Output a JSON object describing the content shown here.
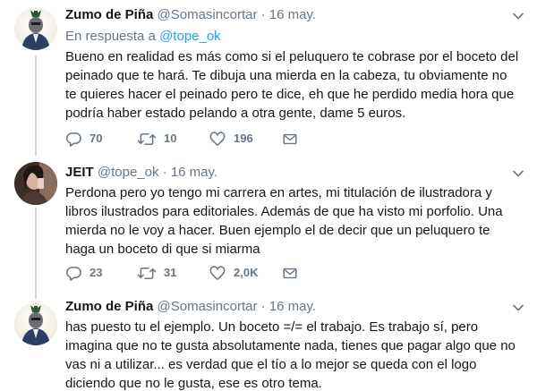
{
  "tweets": [
    {
      "name": "Zumo de Piña",
      "handle": "@Somasincortar",
      "date": "16 may.",
      "replying_prefix": "En respuesta a",
      "replying_to": "@tope_ok",
      "text": "Bueno en realidad es más como si el peluquero te cobrase por el boceto del peinado que te hará. Te dibuja una mierda en la cabeza, tu obviamente no te quieres hacer el peinado pero te dice, eh que he perdido media hora que podría haber estado pelando a otra gente, dame 5 euros.",
      "replies": "70",
      "retweets": "10",
      "likes": "196"
    },
    {
      "name": "JEIT",
      "handle": "@tope_ok",
      "date": "16 may.",
      "text": "Perdona pero yo tengo mi carrera en artes, mi titulación de ilustradora y libros ilustrados para editoriales. Además de que ha visto mi porfolio. Una mierda no le voy a hacer. Buen ejemplo el de decir que un peluquero te haga un boceto di que si miarma",
      "replies": "23",
      "retweets": "31",
      "likes": "2,0K"
    },
    {
      "name": "Zumo de Piña",
      "handle": "@Somasincortar",
      "date": "16 may.",
      "text": "has puesto tu el ejemplo. Un boceto =/= el trabajo. Es trabajo sí, pero imagina que no te gusta absolutamente nada, tienes que pagar algo que no vas ni a utilizar... es verdad que el tío a lo mejor se queda con el logo diciendo que no le gusta, ese es otro tema."
    }
  ],
  "separator": "·",
  "colors": {
    "text": "#14171a",
    "secondary": "#657786",
    "link": "#1da1f2",
    "thread_line": "#ccd6dd"
  },
  "icons": [
    "reply-icon",
    "retweet-icon",
    "like-icon",
    "direct-message-icon",
    "caret-down-icon"
  ]
}
